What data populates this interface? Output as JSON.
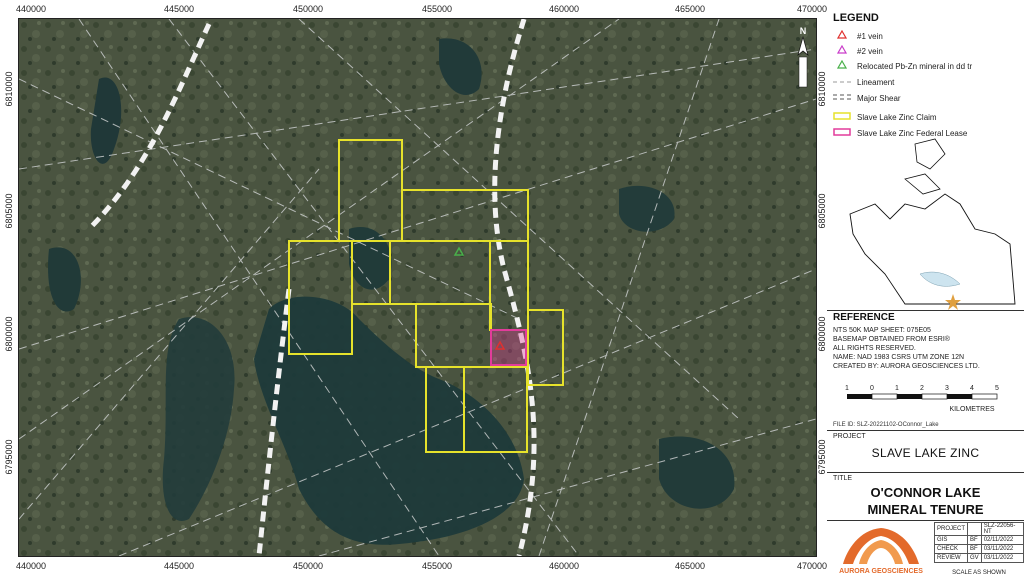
{
  "map": {
    "x_ticks": [
      "440000",
      "445000",
      "450000",
      "455000",
      "460000",
      "465000",
      "470000"
    ],
    "y_ticks": [
      "6810000",
      "6805000",
      "6800000",
      "6795000"
    ],
    "north_label": "N",
    "colors": {
      "background": "#46503a",
      "water": "#1f3a3b",
      "claim": "#e6e22b",
      "lease": "#e23c9b",
      "shear": "#f2f2f2",
      "lineament": "#c9cccc"
    }
  },
  "legend": {
    "title": "LEGEND",
    "items": [
      {
        "label": "#1 vein",
        "icon": "triangle-red-icon"
      },
      {
        "label": "#2 vein",
        "icon": "triangle-magenta-icon"
      },
      {
        "label": "Relocated Pb-Zn mineral in dd tr",
        "icon": "triangle-green-icon"
      },
      {
        "label": "Lineament",
        "icon": "dashed-line-icon"
      },
      {
        "label": "Major Shear",
        "icon": "double-dashed-line-icon"
      },
      {
        "label": "Slave Lake Zinc Claim",
        "icon": "yellow-box-icon"
      },
      {
        "label": "Slave Lake Zinc Federal Lease",
        "icon": "magenta-box-icon"
      }
    ]
  },
  "reference": {
    "title": "REFERENCE",
    "lines": [
      "NTS 50K MAP SHEET: 075E05",
      "BASEMAP OBTAINED FROM ESRI®",
      "ALL RIGHTS RESERVED.",
      "NAME: NAD 1983 CSRS UTM ZONE 12N",
      "CREATED BY: AURORA GEOSCIENCES LTD."
    ],
    "scale_ticks": [
      "1",
      "0",
      "1",
      "2",
      "3",
      "4",
      "5"
    ],
    "scale_unit": "KILOMETRES"
  },
  "file_id": "FILE ID: SLZ-20221102-OConnor_Lake",
  "project": {
    "label": "PROJECT",
    "name": "SLAVE LAKE ZINC"
  },
  "title": {
    "label": "TITLE",
    "line1": "O'CONNOR LAKE",
    "line2": "MINERAL TENURE"
  },
  "info": {
    "rows": [
      [
        "PROJECT",
        "",
        "SLZ-22056-NT"
      ],
      [
        "GIS",
        "BF",
        "02/11/2022"
      ],
      [
        "CHECK",
        "BF",
        "03/11/2022"
      ],
      [
        "REVIEW",
        "GV",
        "03/11/2022"
      ]
    ],
    "scale": "SCALE AS SHOWN"
  },
  "logo": {
    "text": "AURORA GEOSCIENCES"
  }
}
